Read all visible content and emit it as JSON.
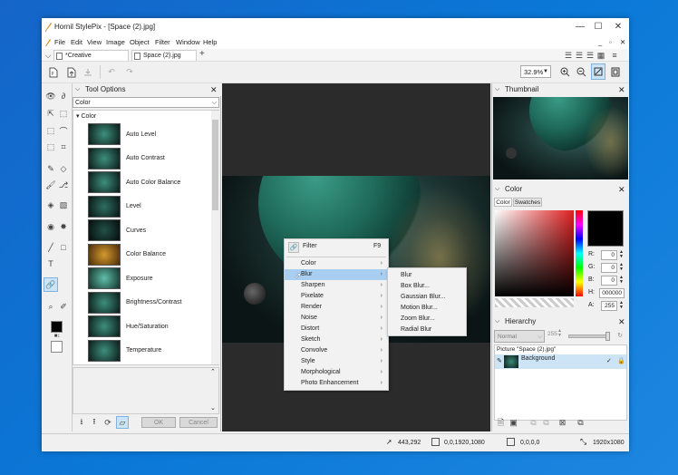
{
  "window": {
    "title": "Hornil StylePix - [Space (2).jpg]",
    "controls": [
      "—",
      "☐",
      "✕"
    ]
  },
  "menubar": [
    "File",
    "Edit",
    "View",
    "Image",
    "Object",
    "Filter",
    "Window",
    "Help"
  ],
  "menubar_right": [
    "_",
    "▫",
    "✕"
  ],
  "tabs": [
    {
      "label": "*Creative _Graphics..."
    },
    {
      "label": "Space (2).jpg"
    }
  ],
  "tab_add": "+",
  "tab_menu": "≡",
  "toolbar": {
    "zoom": "32.9%"
  },
  "tool_options": {
    "title": "Tool Options",
    "category": "Color",
    "tree_root": "Color",
    "items": [
      "Auto Level",
      "Auto Contrast",
      "Auto Color Balance",
      "Level",
      "Curves",
      "Color Balance",
      "Exposure",
      "Brightness/Contrast",
      "Hue/Saturation",
      "Temperature"
    ],
    "ok": "OK",
    "cancel": "Cancel"
  },
  "context_menu": {
    "header": "Filter",
    "shortcut": "F9",
    "items": [
      "Color",
      "Blur",
      "Sharpen",
      "Pixelate",
      "Render",
      "Noise",
      "Distort",
      "Sketch",
      "Convolve",
      "Style",
      "Morphological",
      "Photo Enhancement"
    ],
    "highlighted": "Blur"
  },
  "submenu": {
    "items": [
      "Blur",
      "Box Blur...",
      "Gaussian Blur...",
      "Motion Blur...",
      "Zoom Blur...",
      "Radial Blur"
    ]
  },
  "thumbnail": {
    "title": "Thumbnail"
  },
  "color_panel": {
    "title": "Color",
    "tabs": [
      "Color",
      "Swatches"
    ],
    "r_label": "R:",
    "r": "0",
    "g_label": "G:",
    "g": "0",
    "b_label": "B:",
    "b": "0",
    "h_label": "H:",
    "hex": "000000",
    "a_label": "A:",
    "a": "255"
  },
  "hierarchy": {
    "title": "Hierarchy",
    "blend": "Normal",
    "opacity": "255",
    "picture": "Picture \"Space (2).jpg\"",
    "layer": "Background"
  },
  "statusbar": {
    "cursor": "443,292",
    "selection": "0,0,1920,1080",
    "rect": "0,0,0,0",
    "size": "1920x1080"
  },
  "colors": {
    "accent": "#a8cff1",
    "canvas": "#2b2b2b"
  }
}
